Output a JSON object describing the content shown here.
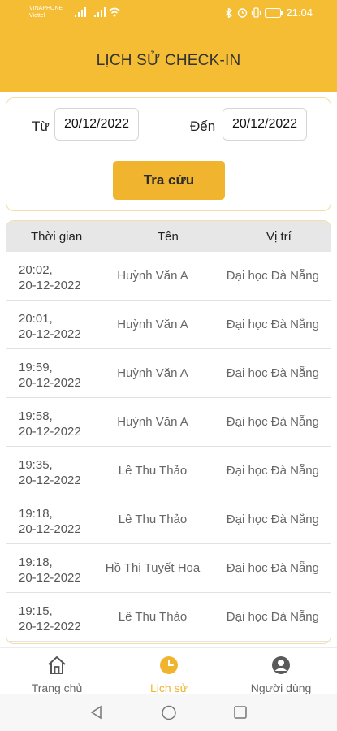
{
  "status_bar": {
    "carrier_1": "VINAPHONE",
    "carrier_2": "Viettel",
    "battery": "81",
    "time": "21:04"
  },
  "header": {
    "title": "LỊCH SỬ CHECK-IN"
  },
  "search": {
    "from_label": "Từ",
    "from_value": "20/12/2022",
    "to_label": "Đến",
    "to_value": "20/12/2022",
    "button_label": "Tra cứu"
  },
  "table": {
    "headers": [
      "Thời gian",
      "Tên",
      "Vị trí"
    ],
    "rows": [
      {
        "time": "20:02,",
        "date": "20-12-2022",
        "name": "Huỳnh Văn A",
        "location": "Đại học Đà Nẵng"
      },
      {
        "time": "20:01,",
        "date": "20-12-2022",
        "name": "Huỳnh Văn A",
        "location": "Đại học Đà Nẵng"
      },
      {
        "time": "19:59,",
        "date": "20-12-2022",
        "name": "Huỳnh Văn A",
        "location": "Đại học Đà Nẵng"
      },
      {
        "time": "19:58,",
        "date": "20-12-2022",
        "name": "Huỳnh Văn A",
        "location": "Đại học Đà Nẵng"
      },
      {
        "time": "19:35,",
        "date": "20-12-2022",
        "name": "Lê Thu Thảo",
        "location": "Đại học Đà Nẵng"
      },
      {
        "time": "19:18,",
        "date": "20-12-2022",
        "name": "Lê Thu Thảo",
        "location": "Đại học Đà Nẵng"
      },
      {
        "time": "19:18,",
        "date": "20-12-2022",
        "name": "Hồ Thị Tuyết Hoa",
        "location": "Đại học Đà Nẵng"
      },
      {
        "time": "19:15,",
        "date": "20-12-2022",
        "name": "Lê Thu Thảo",
        "location": "Đại học Đà Nẵng"
      }
    ]
  },
  "bottom_nav": {
    "items": [
      {
        "label": "Trang chủ",
        "icon": "home-icon",
        "active": false
      },
      {
        "label": "Lịch sử",
        "icon": "clock-icon",
        "active": true
      },
      {
        "label": "Người dùng",
        "icon": "user-icon",
        "active": false
      }
    ]
  },
  "colors": {
    "accent": "#f4bd34",
    "button": "#f1b42f",
    "active_nav": "#f1b42f"
  }
}
